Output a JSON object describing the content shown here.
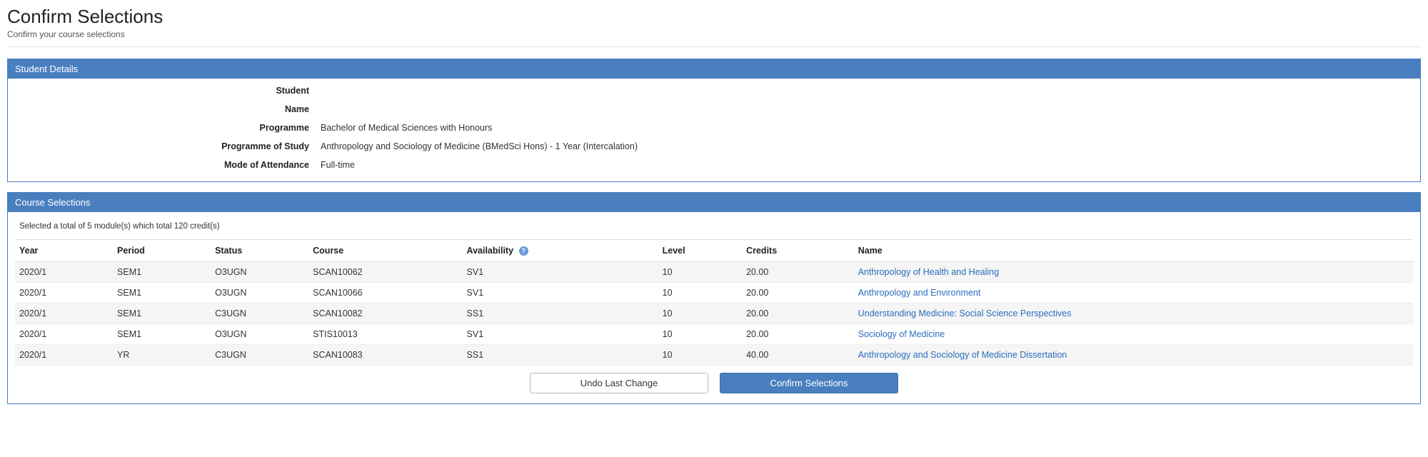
{
  "header": {
    "title": "Confirm Selections",
    "subtitle": "Confirm your course selections"
  },
  "studentDetails": {
    "panelTitle": "Student Details",
    "labels": {
      "student": "Student",
      "name": "Name",
      "programme": "Programme",
      "programmeOfStudy": "Programme of Study",
      "modeOfAttendance": "Mode of Attendance"
    },
    "values": {
      "student": "",
      "name": "",
      "programme": "Bachelor of Medical Sciences with Honours",
      "programmeOfStudy": "Anthropology and Sociology of Medicine (BMedSci Hons) - 1 Year (Intercalation)",
      "modeOfAttendance": "Full-time"
    }
  },
  "courseSelections": {
    "panelTitle": "Course Selections",
    "summary": "Selected a total of 5 module(s) which total 120 credit(s)",
    "columns": {
      "year": "Year",
      "period": "Period",
      "status": "Status",
      "course": "Course",
      "availability": "Availability",
      "level": "Level",
      "credits": "Credits",
      "name": "Name"
    },
    "rows": [
      {
        "year": "2020/1",
        "period": "SEM1",
        "status": "O3UGN",
        "course": "SCAN10062",
        "availability": "SV1",
        "level": "10",
        "credits": "20.00",
        "name": "Anthropology of Health and Healing"
      },
      {
        "year": "2020/1",
        "period": "SEM1",
        "status": "O3UGN",
        "course": "SCAN10066",
        "availability": "SV1",
        "level": "10",
        "credits": "20.00",
        "name": "Anthropology and Environment"
      },
      {
        "year": "2020/1",
        "period": "SEM1",
        "status": "C3UGN",
        "course": "SCAN10082",
        "availability": "SS1",
        "level": "10",
        "credits": "20.00",
        "name": "Understanding Medicine: Social Science Perspectives"
      },
      {
        "year": "2020/1",
        "period": "SEM1",
        "status": "O3UGN",
        "course": "STIS10013",
        "availability": "SV1",
        "level": "10",
        "credits": "20.00",
        "name": "Sociology of Medicine"
      },
      {
        "year": "2020/1",
        "period": "YR",
        "status": "C3UGN",
        "course": "SCAN10083",
        "availability": "SS1",
        "level": "10",
        "credits": "40.00",
        "name": "Anthropology and Sociology of Medicine Dissertation"
      }
    ]
  },
  "actions": {
    "undo": "Undo Last Change",
    "confirm": "Confirm Selections"
  },
  "icons": {
    "info": "?"
  }
}
